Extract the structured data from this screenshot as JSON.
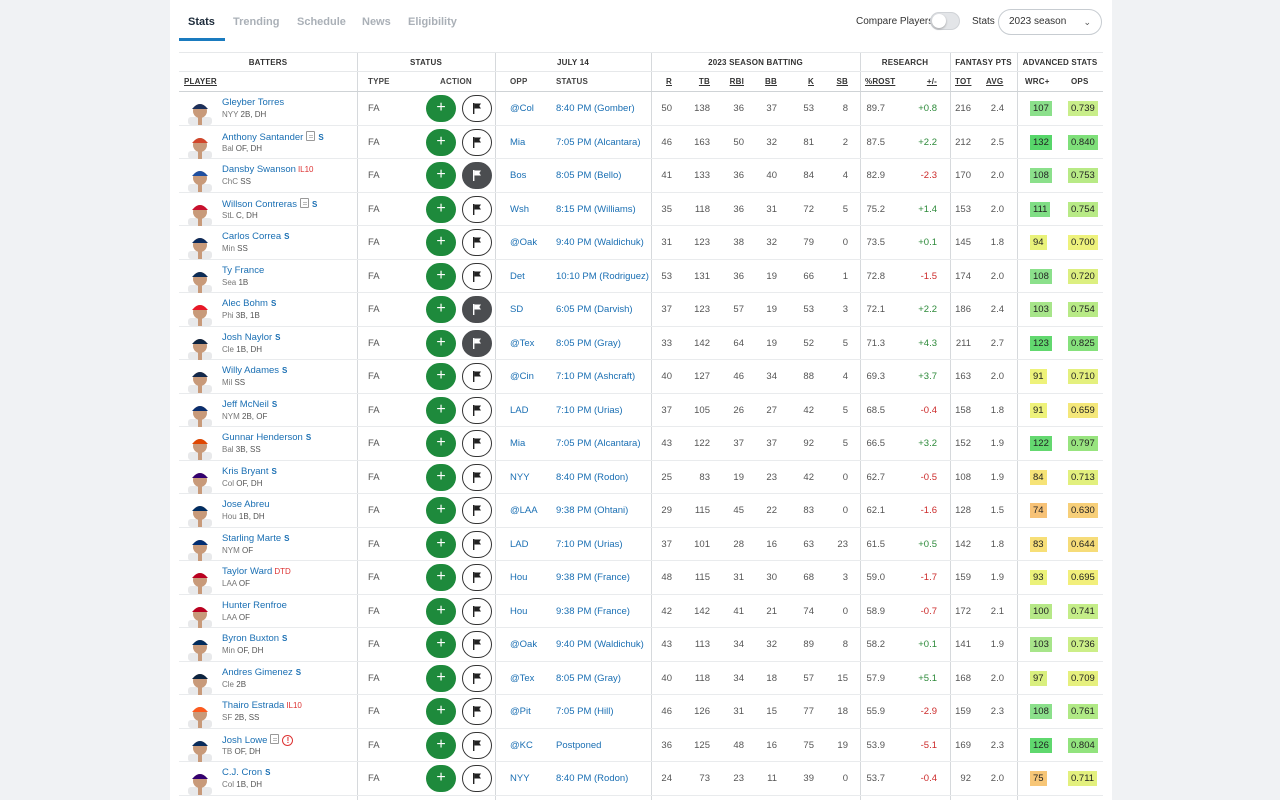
{
  "tabs": [
    "Stats",
    "Trending",
    "Schedule",
    "News",
    "Eligibility"
  ],
  "controls": {
    "compare_label": "Compare Players",
    "stats_label": "Stats",
    "season_value": "2023 season"
  },
  "header_groups": {
    "batters": "BATTERS",
    "status": "STATUS",
    "date": "JULY 14",
    "season_batting": "2023 SEASON BATTING",
    "research": "RESEARCH",
    "fantasy_pts": "FANTASY PTS",
    "advanced": "ADVANCED STATS"
  },
  "columns": {
    "player": "PLAYER",
    "type": "TYPE",
    "action": "ACTION",
    "opp": "OPP",
    "status": "STATUS",
    "r": "R",
    "tb": "TB",
    "rbi": "RBI",
    "bb": "BB",
    "k": "K",
    "sb": "SB",
    "rost": "%ROST",
    "change": "+/-",
    "tot": "TOT",
    "avg": "AVG",
    "wrc": "WRC+",
    "ops": "OPS"
  },
  "colors": {
    "accent": "#1a7bbf",
    "add_green": "#1e8a3c",
    "link_blue": "#1a6fb3",
    "positive": "#2d8a3a",
    "negative": "#cc2a2a"
  },
  "players": [
    {
      "name": "Gleyber Torres",
      "team": "NYY",
      "pos": "2B, DH",
      "inj": "",
      "s": false,
      "note": false,
      "alert": false,
      "type": "FA",
      "flag_dark": false,
      "opp": "@Col",
      "game": "8:40 PM (Gomber)",
      "r": 50,
      "tb": 138,
      "rbi": 36,
      "bb": 37,
      "k": 53,
      "sb": 8,
      "rost": "89.7",
      "chg": "+0.8",
      "tot": 216,
      "avg": "2.4",
      "wrc": 107,
      "ops": "0.739",
      "wrc_color": "#8be08b",
      "ops_color": "#c9ee8a"
    },
    {
      "name": "Anthony Santander",
      "team": "Bal",
      "pos": "OF, DH",
      "inj": "",
      "s": true,
      "note": true,
      "alert": false,
      "type": "FA",
      "flag_dark": false,
      "opp": "Mia",
      "game": "7:05 PM (Alcantara)",
      "r": 46,
      "tb": 163,
      "rbi": 50,
      "bb": 32,
      "k": 81,
      "sb": 2,
      "rost": "87.5",
      "chg": "+2.2",
      "tot": 212,
      "avg": "2.5",
      "wrc": 132,
      "ops": "0.840",
      "wrc_color": "#57d66a",
      "ops_color": "#7fe07a"
    },
    {
      "name": "Dansby Swanson",
      "team": "ChC",
      "pos": "SS",
      "inj": "IL10",
      "s": false,
      "note": false,
      "alert": false,
      "type": "FA",
      "flag_dark": true,
      "opp": "Bos",
      "game": "8:05 PM (Bello)",
      "r": 41,
      "tb": 133,
      "rbi": 36,
      "bb": 40,
      "k": 84,
      "sb": 4,
      "rost": "82.9",
      "chg": "-2.3",
      "tot": 170,
      "avg": "2.0",
      "wrc": 108,
      "ops": "0.753",
      "wrc_color": "#8be08b",
      "ops_color": "#b8ea86"
    },
    {
      "name": "Willson Contreras",
      "team": "StL",
      "pos": "C, DH",
      "inj": "",
      "s": true,
      "note": true,
      "alert": false,
      "type": "FA",
      "flag_dark": false,
      "opp": "Wsh",
      "game": "8:15 PM (Williams)",
      "r": 35,
      "tb": 118,
      "rbi": 36,
      "bb": 31,
      "k": 72,
      "sb": 5,
      "rost": "75.2",
      "chg": "+1.4",
      "tot": 153,
      "avg": "2.0",
      "wrc": 111,
      "ops": "0.754",
      "wrc_color": "#80de85",
      "ops_color": "#b8ea86"
    },
    {
      "name": "Carlos Correa",
      "team": "Min",
      "pos": "SS",
      "inj": "",
      "s": true,
      "note": false,
      "alert": false,
      "type": "FA",
      "flag_dark": false,
      "opp": "@Oak",
      "game": "9:40 PM (Waldichuk)",
      "r": 31,
      "tb": 123,
      "rbi": 38,
      "bb": 32,
      "k": 79,
      "sb": 0,
      "rost": "73.5",
      "chg": "+0.1",
      "tot": 145,
      "avg": "1.8",
      "wrc": 94,
      "ops": "0.700",
      "wrc_color": "#e9f27a",
      "ops_color": "#eef27c"
    },
    {
      "name": "Ty France",
      "team": "Sea",
      "pos": "1B",
      "inj": "",
      "s": false,
      "note": false,
      "alert": false,
      "type": "FA",
      "flag_dark": false,
      "opp": "Det",
      "game": "10:10 PM (Rodriguez)",
      "r": 53,
      "tb": 131,
      "rbi": 36,
      "bb": 19,
      "k": 66,
      "sb": 1,
      "rost": "72.8",
      "chg": "-1.5",
      "tot": 174,
      "avg": "2.0",
      "wrc": 108,
      "ops": "0.720",
      "wrc_color": "#8be08b",
      "ops_color": "#dcef80"
    },
    {
      "name": "Alec Bohm",
      "team": "Phi",
      "pos": "3B, 1B",
      "inj": "",
      "s": true,
      "note": false,
      "alert": false,
      "type": "FA",
      "flag_dark": true,
      "opp": "SD",
      "game": "6:05 PM (Darvish)",
      "r": 37,
      "tb": 123,
      "rbi": 57,
      "bb": 19,
      "k": 53,
      "sb": 3,
      "rost": "72.1",
      "chg": "+2.2",
      "tot": 186,
      "avg": "2.4",
      "wrc": 103,
      "ops": "0.754",
      "wrc_color": "#a7e58a",
      "ops_color": "#b8ea86"
    },
    {
      "name": "Josh Naylor",
      "team": "Cle",
      "pos": "1B, DH",
      "inj": "",
      "s": true,
      "note": false,
      "alert": false,
      "type": "FA",
      "flag_dark": true,
      "opp": "@Tex",
      "game": "8:05 PM (Gray)",
      "r": 33,
      "tb": 142,
      "rbi": 64,
      "bb": 19,
      "k": 52,
      "sb": 5,
      "rost": "71.3",
      "chg": "+4.3",
      "tot": 211,
      "avg": "2.7",
      "wrc": 123,
      "ops": "0.825",
      "wrc_color": "#62d86f",
      "ops_color": "#86e17c"
    },
    {
      "name": "Willy Adames",
      "team": "Mil",
      "pos": "SS",
      "inj": "",
      "s": true,
      "note": false,
      "alert": false,
      "type": "FA",
      "flag_dark": false,
      "opp": "@Cin",
      "game": "7:10 PM (Ashcraft)",
      "r": 40,
      "tb": 127,
      "rbi": 46,
      "bb": 34,
      "k": 88,
      "sb": 4,
      "rost": "69.3",
      "chg": "+3.7",
      "tot": 163,
      "avg": "2.0",
      "wrc": 91,
      "ops": "0.710",
      "wrc_color": "#eef27a",
      "ops_color": "#e4f07e"
    },
    {
      "name": "Jeff McNeil",
      "team": "NYM",
      "pos": "2B, OF",
      "inj": "",
      "s": true,
      "note": false,
      "alert": false,
      "type": "FA",
      "flag_dark": false,
      "opp": "LAD",
      "game": "7:10 PM (Urias)",
      "r": 37,
      "tb": 105,
      "rbi": 26,
      "bb": 27,
      "k": 42,
      "sb": 5,
      "rost": "68.5",
      "chg": "-0.4",
      "tot": 158,
      "avg": "1.8",
      "wrc": 91,
      "ops": "0.659",
      "wrc_color": "#eef27a",
      "ops_color": "#f4e77a"
    },
    {
      "name": "Gunnar Henderson",
      "team": "Bal",
      "pos": "3B, SS",
      "inj": "",
      "s": true,
      "note": false,
      "alert": false,
      "type": "FA",
      "flag_dark": false,
      "opp": "Mia",
      "game": "7:05 PM (Alcantara)",
      "r": 43,
      "tb": 122,
      "rbi": 37,
      "bb": 37,
      "k": 92,
      "sb": 5,
      "rost": "66.5",
      "chg": "+3.2",
      "tot": 152,
      "avg": "1.9",
      "wrc": 122,
      "ops": "0.797",
      "wrc_color": "#64d870",
      "ops_color": "#98e47f"
    },
    {
      "name": "Kris Bryant",
      "team": "Col",
      "pos": "OF, DH",
      "inj": "",
      "s": true,
      "note": false,
      "alert": false,
      "type": "FA",
      "flag_dark": false,
      "opp": "NYY",
      "game": "8:40 PM (Rodon)",
      "r": 25,
      "tb": 83,
      "rbi": 19,
      "bb": 23,
      "k": 42,
      "sb": 0,
      "rost": "62.7",
      "chg": "-0.5",
      "tot": 108,
      "avg": "1.9",
      "wrc": 84,
      "ops": "0.713",
      "wrc_color": "#f6e377",
      "ops_color": "#e2f07e"
    },
    {
      "name": "Jose Abreu",
      "team": "Hou",
      "pos": "1B, DH",
      "inj": "",
      "s": false,
      "note": false,
      "alert": false,
      "type": "FA",
      "flag_dark": false,
      "opp": "@LAA",
      "game": "9:38 PM (Ohtani)",
      "r": 29,
      "tb": 115,
      "rbi": 45,
      "bb": 22,
      "k": 83,
      "sb": 0,
      "rost": "62.1",
      "chg": "-1.6",
      "tot": 128,
      "avg": "1.5",
      "wrc": 74,
      "ops": "0.630",
      "wrc_color": "#f7c277",
      "ops_color": "#f7cf79"
    },
    {
      "name": "Starling Marte",
      "team": "NYM",
      "pos": "OF",
      "inj": "",
      "s": true,
      "note": false,
      "alert": false,
      "type": "FA",
      "flag_dark": false,
      "opp": "LAD",
      "game": "7:10 PM (Urias)",
      "r": 37,
      "tb": 101,
      "rbi": 28,
      "bb": 16,
      "k": 63,
      "sb": 23,
      "rost": "61.5",
      "chg": "+0.5",
      "tot": 142,
      "avg": "1.8",
      "wrc": 83,
      "ops": "0.644",
      "wrc_color": "#f7df77",
      "ops_color": "#f6dc79"
    },
    {
      "name": "Taylor Ward",
      "team": "LAA",
      "pos": "OF",
      "inj": "DTD",
      "s": false,
      "note": false,
      "alert": false,
      "type": "FA",
      "flag_dark": false,
      "opp": "Hou",
      "game": "9:38 PM (France)",
      "r": 48,
      "tb": 115,
      "rbi": 31,
      "bb": 30,
      "k": 68,
      "sb": 3,
      "rost": "59.0",
      "chg": "-1.7",
      "tot": 159,
      "avg": "1.9",
      "wrc": 93,
      "ops": "0.695",
      "wrc_color": "#ebf27a",
      "ops_color": "#f2ef7b"
    },
    {
      "name": "Hunter Renfroe",
      "team": "LAA",
      "pos": "OF",
      "inj": "",
      "s": false,
      "note": false,
      "alert": false,
      "type": "FA",
      "flag_dark": false,
      "opp": "Hou",
      "game": "9:38 PM (France)",
      "r": 42,
      "tb": 142,
      "rbi": 41,
      "bb": 21,
      "k": 74,
      "sb": 0,
      "rost": "58.9",
      "chg": "-0.7",
      "tot": 172,
      "avg": "2.1",
      "wrc": 100,
      "ops": "0.741",
      "wrc_color": "#b6e887",
      "ops_color": "#c4ed88"
    },
    {
      "name": "Byron Buxton",
      "team": "Min",
      "pos": "OF, DH",
      "inj": "",
      "s": true,
      "note": false,
      "alert": false,
      "type": "FA",
      "flag_dark": false,
      "opp": "@Oak",
      "game": "9:40 PM (Waldichuk)",
      "r": 43,
      "tb": 113,
      "rbi": 34,
      "bb": 32,
      "k": 89,
      "sb": 8,
      "rost": "58.2",
      "chg": "+0.1",
      "tot": 141,
      "avg": "1.9",
      "wrc": 103,
      "ops": "0.736",
      "wrc_color": "#a7e58a",
      "ops_color": "#ccee88"
    },
    {
      "name": "Andres Gimenez",
      "team": "Cle",
      "pos": "2B",
      "inj": "",
      "s": true,
      "note": false,
      "alert": false,
      "type": "FA",
      "flag_dark": false,
      "opp": "@Tex",
      "game": "8:05 PM (Gray)",
      "r": 40,
      "tb": 118,
      "rbi": 34,
      "bb": 18,
      "k": 57,
      "sb": 15,
      "rost": "57.9",
      "chg": "+5.1",
      "tot": 168,
      "avg": "2.0",
      "wrc": 97,
      "ops": "0.709",
      "wrc_color": "#d9ef7e",
      "ops_color": "#e6f07e"
    },
    {
      "name": "Thairo Estrada",
      "team": "SF",
      "pos": "2B, SS",
      "inj": "IL10",
      "s": false,
      "note": false,
      "alert": false,
      "type": "FA",
      "flag_dark": false,
      "opp": "@Pit",
      "game": "7:05 PM (Hill)",
      "r": 46,
      "tb": 126,
      "rbi": 31,
      "bb": 15,
      "k": 77,
      "sb": 18,
      "rost": "55.9",
      "chg": "-2.9",
      "tot": 159,
      "avg": "2.3",
      "wrc": 108,
      "ops": "0.761",
      "wrc_color": "#8be08b",
      "ops_color": "#b0e985"
    },
    {
      "name": "Josh Lowe",
      "team": "TB",
      "pos": "OF, DH",
      "inj": "",
      "s": false,
      "note": true,
      "alert": true,
      "type": "FA",
      "flag_dark": false,
      "opp": "@KC",
      "game": "Postponed",
      "r": 36,
      "tb": 125,
      "rbi": 48,
      "bb": 16,
      "k": 75,
      "sb": 19,
      "rost": "53.9",
      "chg": "-5.1",
      "tot": 169,
      "avg": "2.3",
      "wrc": 126,
      "ops": "0.804",
      "wrc_color": "#5fd86e",
      "ops_color": "#92e37e"
    },
    {
      "name": "C.J. Cron",
      "team": "Col",
      "pos": "1B, DH",
      "inj": "",
      "s": true,
      "note": false,
      "alert": false,
      "type": "FA",
      "flag_dark": false,
      "opp": "NYY",
      "game": "8:40 PM (Rodon)",
      "r": 24,
      "tb": 73,
      "rbi": 23,
      "bb": 11,
      "k": 39,
      "sb": 0,
      "rost": "53.7",
      "chg": "-0.4",
      "tot": 92,
      "avg": "2.0",
      "wrc": 75,
      "ops": "0.711",
      "wrc_color": "#f7c677",
      "ops_color": "#e3f07e"
    }
  ]
}
